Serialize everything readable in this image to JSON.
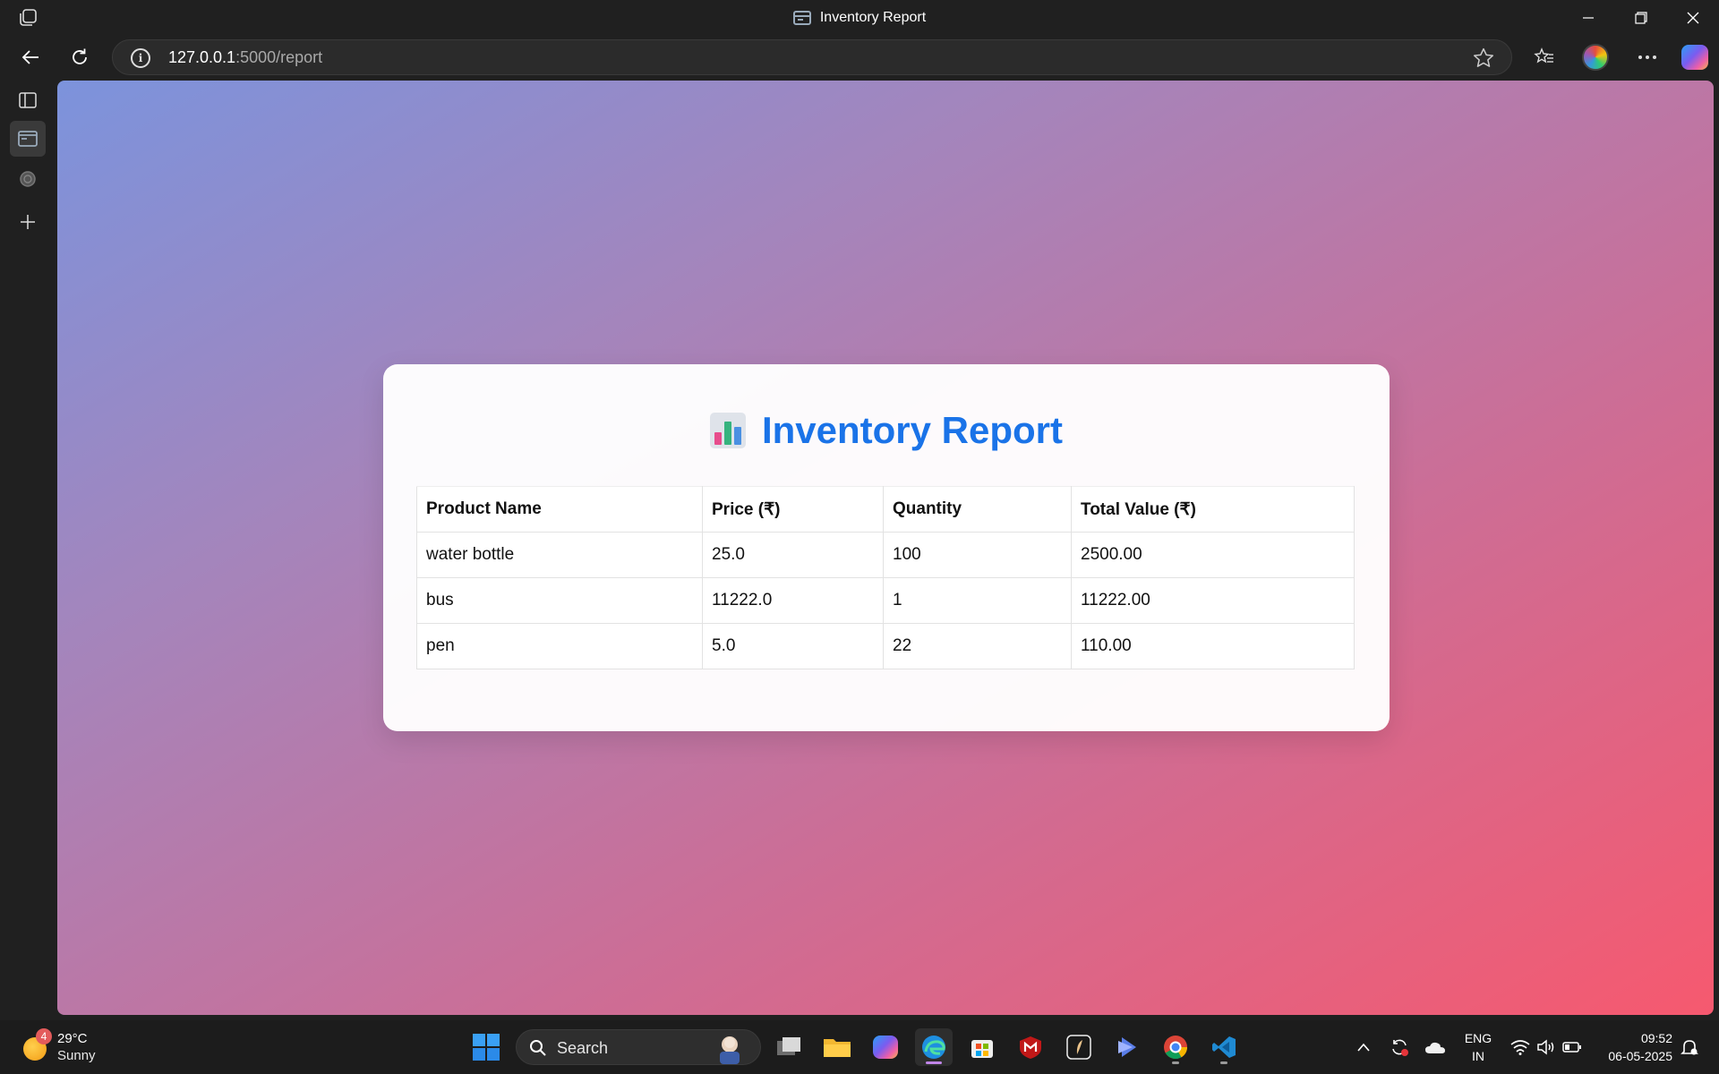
{
  "window": {
    "title": "Inventory Report"
  },
  "browser": {
    "url_host": "127.0.0.1",
    "url_path": ":5000/report"
  },
  "page": {
    "heading": "Inventory Report",
    "heading_icon": "bar-chart-emoji",
    "accent_color": "#1a73e8",
    "table": {
      "headers": [
        "Product Name",
        "Price (₹)",
        "Quantity",
        "Total Value (₹)"
      ],
      "rows": [
        [
          "water bottle",
          "25.0",
          "100",
          "2500.00"
        ],
        [
          "bus",
          "11222.0",
          "1",
          "11222.00"
        ],
        [
          "pen",
          "5.0",
          "22",
          "110.00"
        ]
      ]
    }
  },
  "taskbar": {
    "weather": {
      "badge": "4",
      "temp": "29°C",
      "desc": "Sunny"
    },
    "search_label": "Search",
    "lang_top": "ENG",
    "lang_bottom": "IN",
    "time": "09:52",
    "date": "06-05-2025"
  }
}
